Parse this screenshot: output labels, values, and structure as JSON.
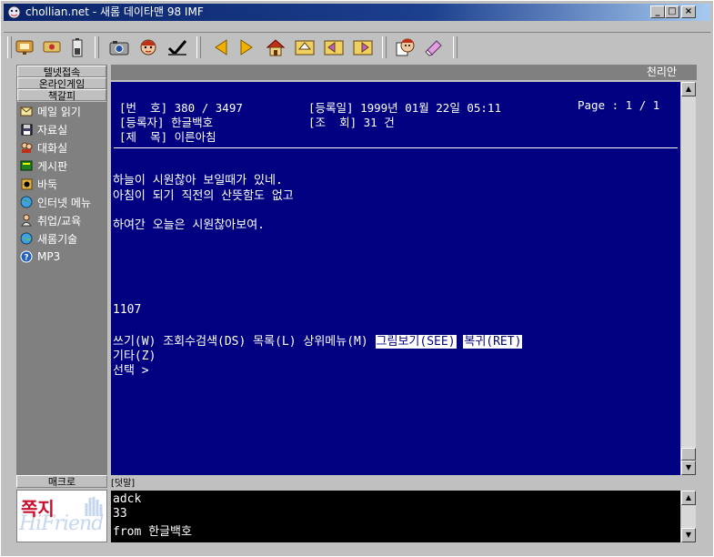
{
  "window": {
    "title": "chollian.net - 새롬 데이타맨 98 IMF",
    "minimize": "_",
    "maximize": "□",
    "close": "×"
  },
  "toolbar": {
    "icons": [
      "phone-icon",
      "handset-icon",
      "battery-icon",
      "camera-icon",
      "avatar-icon",
      "check-icon",
      "left-arrow-icon",
      "right-arrow-icon",
      "home-icon",
      "up-arrow-icon",
      "back-icon",
      "forward-icon",
      "face-icon",
      "eraser-icon"
    ]
  },
  "sidebar": {
    "tabs": [
      "텔넷접속",
      "온라인게임",
      "책갈피"
    ],
    "items": [
      {
        "label": "메일 읽기",
        "icon": "mail-icon"
      },
      {
        "label": "자료실",
        "icon": "disk-icon"
      },
      {
        "label": "대화실",
        "icon": "people-icon"
      },
      {
        "label": "게시판",
        "icon": "board-icon"
      },
      {
        "label": "바둑",
        "icon": "baduk-icon"
      },
      {
        "label": "인터넷 메뉴",
        "icon": "globe-icon"
      },
      {
        "label": "취업/교육",
        "icon": "person-icon"
      },
      {
        "label": "새롬기술",
        "icon": "globe-icon"
      },
      {
        "label": "MP3",
        "icon": "help-icon"
      }
    ],
    "macro_label": "매크로",
    "banner": {
      "title": "쪽지",
      "brand": "HiFriend"
    }
  },
  "terminal": {
    "site_name": "천리안",
    "header": {
      "row1_left": "[번  호] 380 / 3497",
      "row1_mid": "[등록일] 1999년 01월 22일 05:11",
      "row1_right": "Page : 1 / 1",
      "row2_left": "[등록자] 한글백호",
      "row2_mid": "[조  회] 31 건",
      "row3_left": "[제  목] 이른아침"
    },
    "body": [
      "하늘이 시원찮아 보일때가 있네.",
      "아침이 되기 직전의 산뜻함도 없고",
      "",
      "하여간 오늘은 시원찮아보여."
    ],
    "counter": "1107",
    "menu_line1": "쓰기(W) 조회수검색(DS) 목록(L) 상위메뉴(M) ",
    "menu_highlight1": "그림보기(SEE)",
    "menu_highlight2": "복귀(RET)",
    "menu_line2": "기타(Z)",
    "prompt": "선택 >"
  },
  "reply": {
    "label": "[덧말]",
    "lines": [
      "adck",
      "33",
      "from 한글백호"
    ]
  }
}
